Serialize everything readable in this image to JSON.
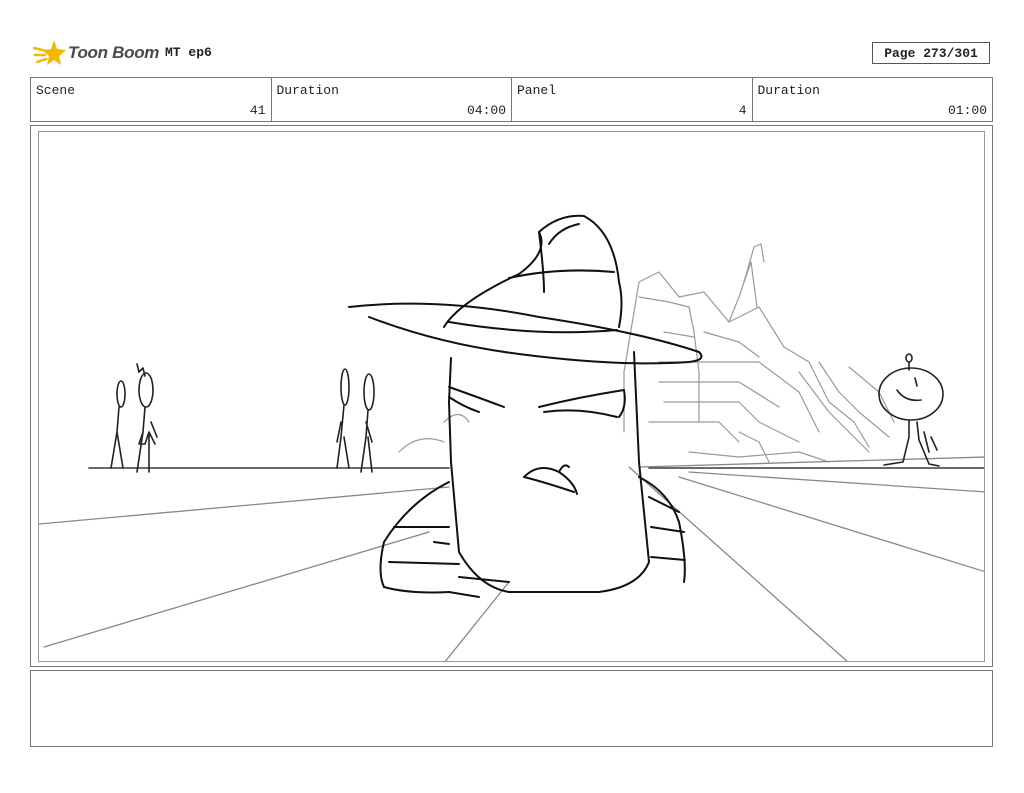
{
  "header": {
    "logo_text": "Toon Boom",
    "project": "MT ep6",
    "page": "Page 273/301"
  },
  "info": {
    "scene_label": "Scene",
    "scene_value": "41",
    "duration_label": "Duration",
    "duration_value": "04:00",
    "panel_label": "Panel",
    "panel_value": "4",
    "panel_duration_label": "Duration",
    "panel_duration_value": "01:00"
  },
  "notes": {
    "text": ""
  },
  "colors": {
    "logo_accent": "#f5b800",
    "sketch_ink": "#111111",
    "sketch_light": "#9a9a9a"
  }
}
